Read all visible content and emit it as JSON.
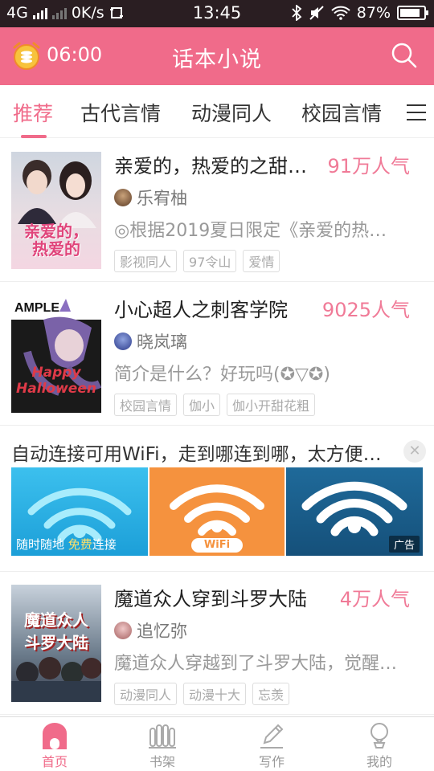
{
  "status_bar": {
    "network": "4G",
    "speed": "0K/s",
    "time": "13:45",
    "battery": "87%",
    "battery_level": 0.87
  },
  "header": {
    "alarm_time": "06:00",
    "title": "话本小说",
    "accent_color": "#f06b8a"
  },
  "tabs": [
    "推荐",
    "古代言情",
    "动漫同人",
    "校园言情"
  ],
  "books": [
    {
      "title": "亲爱的，热爱的之甜…",
      "popularity": "91万人气",
      "author": "乐宥柚",
      "description": "◎根据2019夏日限定《亲爱的热…",
      "tags": [
        "影视同人",
        "97令山",
        "爱情"
      ],
      "cover_text": "亲爱的，热爱的"
    },
    {
      "title": "小心超人之刺客学院",
      "popularity": "9025人气",
      "author": "晓岚璃",
      "description": "简介是什么？好玩吗(✪▽✪)",
      "tags": [
        "校园言情",
        "伽小",
        "伽小开甜花粗"
      ],
      "cover_text": "Happy Halloween"
    },
    {
      "title": "魔道众人穿到斗罗大陆",
      "popularity": "4万人气",
      "author": "追忆弥",
      "description": "魔道众人穿越到了斗罗大陆，觉醒…",
      "tags": [
        "动漫同人",
        "动漫十大",
        "忘羡"
      ],
      "cover_text": "魔道众人 斗罗大陆"
    }
  ],
  "ad": {
    "text": "自动连接可用WiFi，走到哪连到哪，太方便…",
    "caption_prefix": "随时随地 ",
    "caption_highlight": "免费",
    "caption_suffix": "连接",
    "wifi_label": "WiFi",
    "badge": "广告"
  },
  "bottom_nav": [
    "首页",
    "书架",
    "写作",
    "我的"
  ]
}
